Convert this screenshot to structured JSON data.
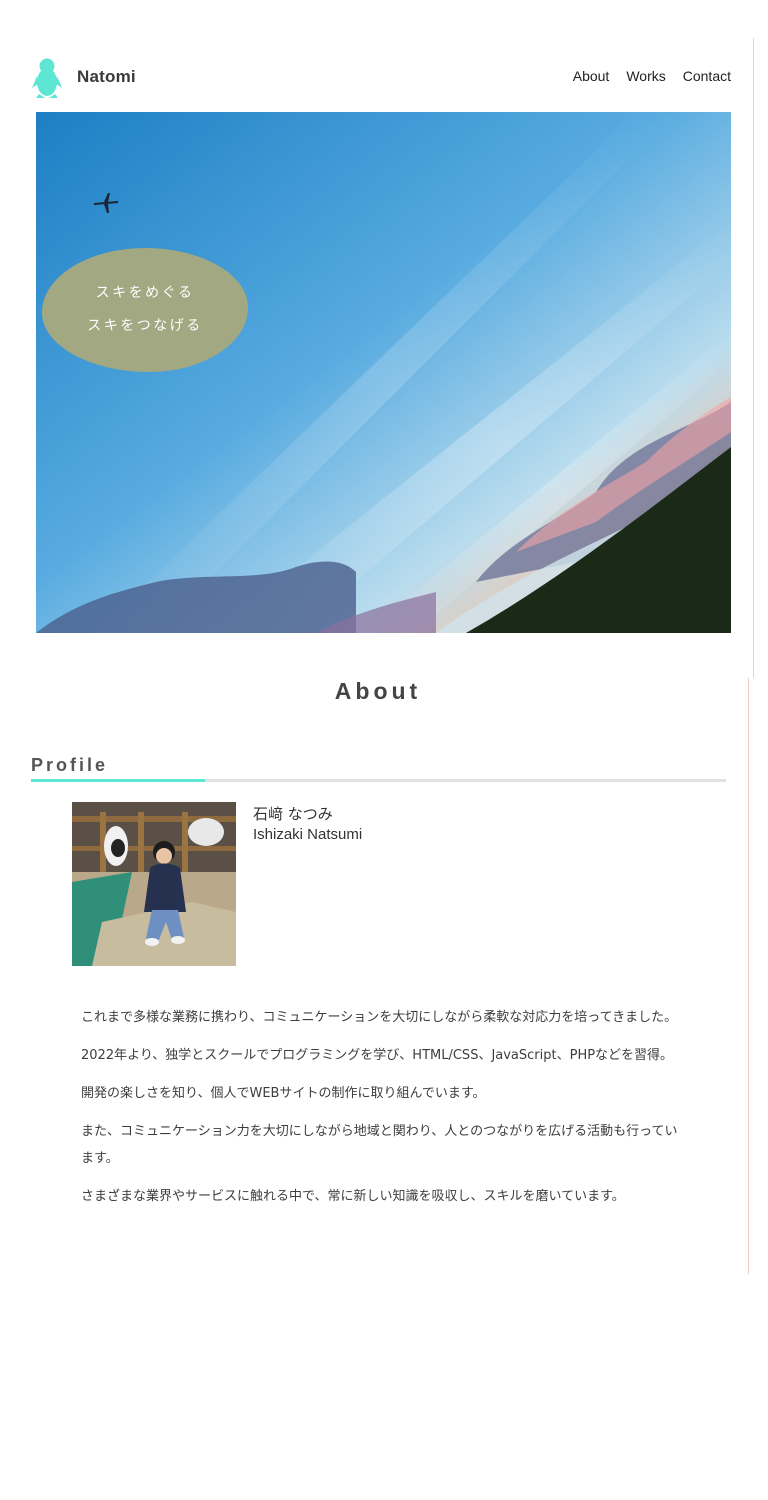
{
  "header": {
    "brand": "Natomi",
    "logo_icon": "penguin-icon",
    "nav": [
      "About",
      "Works",
      "Contact"
    ]
  },
  "hero": {
    "tagline": [
      "スキをめぐる",
      "スキをつなげる"
    ],
    "airplane_icon": "airplane-icon"
  },
  "about": {
    "title": "About",
    "profile_heading": "Profile",
    "name_jp": "石﨑 なつみ",
    "name_en": "Ishizaki Natsumi",
    "bio": [
      "これまで多様な業務に携わり、コミュニケーションを大切にしながら柔軟な対応力を培ってきました。",
      "2022年より、独学とスクールでプログラミングを学び、HTML/CSS、JavaScript、PHPなどを習得。",
      "開発の楽しさを知り、個人でWEBサイトの制作に取り組んでいます。",
      "また、コミュニケーション力を大切にしながら地域と関わり、人とのつながりを広げる活動も行っています。",
      "さまざまな業界やサービスに触れる中で、常に新しい知識を吸収し、スキルを磨いています。"
    ]
  },
  "colors": {
    "accent": "#5ee6d4",
    "blob": "#a2a882",
    "text": "#333333"
  }
}
